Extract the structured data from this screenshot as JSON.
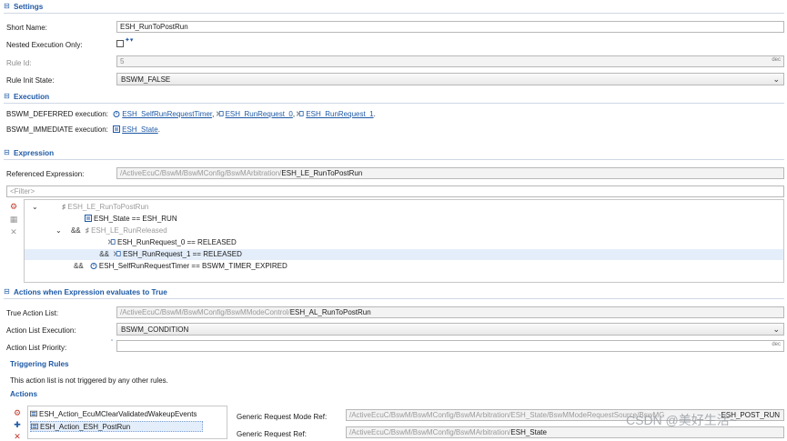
{
  "settings": {
    "title": "Settings",
    "short_name_label": "Short Name:",
    "short_name_value": "ESH_RunToPostRun",
    "nested_label": "Nested Execution Only:",
    "rule_id_label": "Rule Id:",
    "rule_id_value": "5",
    "rule_id_suffix": "dec",
    "rule_init_label": "Rule Init State:",
    "rule_init_value": "BSWM_FALSE"
  },
  "execution": {
    "title": "Execution",
    "deferred_label": "BSWM_DEFERRED execution:",
    "deferred_links": [
      "ESH_SelfRunRequestTimer",
      "ESH_RunRequest_0",
      "ESH_RunRequest_1"
    ],
    "immediate_label": "BSWM_IMMEDIATE execution:",
    "immediate_link": "ESH_State"
  },
  "expression": {
    "title": "Expression",
    "ref_label": "Referenced Expression:",
    "ref_prefix": "/ActiveEcuC/BswM/BswMConfig/BswMArbitration/",
    "ref_value": "ESH_LE_RunToPostRun",
    "filter_placeholder": "<Filter>",
    "tree": [
      {
        "prefix": "",
        "text": "ESH_LE_RunToPostRun"
      },
      {
        "prefix": "",
        "text": "ESH_State == ESH_RUN"
      },
      {
        "prefix": "&&",
        "text": "ESH_LE_RunReleased"
      },
      {
        "prefix": "",
        "text": "ESH_RunRequest_0 == RELEASED"
      },
      {
        "prefix": "&&",
        "text": "ESH_RunRequest_1 == RELEASED"
      },
      {
        "prefix": "&&",
        "text": "ESH_SelfRunRequestTimer == BSWM_TIMER_EXPIRED"
      }
    ]
  },
  "actions": {
    "title": "Actions when Expression evaluates to True",
    "true_list_label": "True Action List:",
    "true_list_prefix": "/ActiveEcuC/BswM/BswMConfig/BswMModeControl/",
    "true_list_value": "ESH_AL_RunToPostRun",
    "exec_label": "Action List Execution:",
    "exec_value": "BSWM_CONDITION",
    "priority_label": "Action List Priority:",
    "priority_suffix": "dec",
    "triggering_title": "Triggering Rules",
    "triggering_text": "This action list is not triggered by any other rules.",
    "actions_title": "Actions",
    "action_items": [
      "ESH_Action_EcuMClearValidatedWakeupEvents",
      "ESH_Action_ESH_PostRun"
    ],
    "gen_mode_label": "Generic Request Mode Ref:",
    "gen_mode_prefix": "/ActiveEcuC/BswM/BswMConfig/BswMArbitration/ESH_State/BswMModeRequestSource/BswMG",
    "gen_mode_value": "ESH_POST_RUN",
    "gen_ref_label": "Generic Request Ref:",
    "gen_ref_prefix": "/ActiveEcuC/BswM/BswMConfig/BswMArbitration/",
    "gen_ref_value": "ESH_State"
  },
  "watermark": "CSDN @美好生活~",
  "colors": {
    "section": "#1f5aa6",
    "link": "#1f5aa6",
    "selection": "#e4eefb"
  }
}
